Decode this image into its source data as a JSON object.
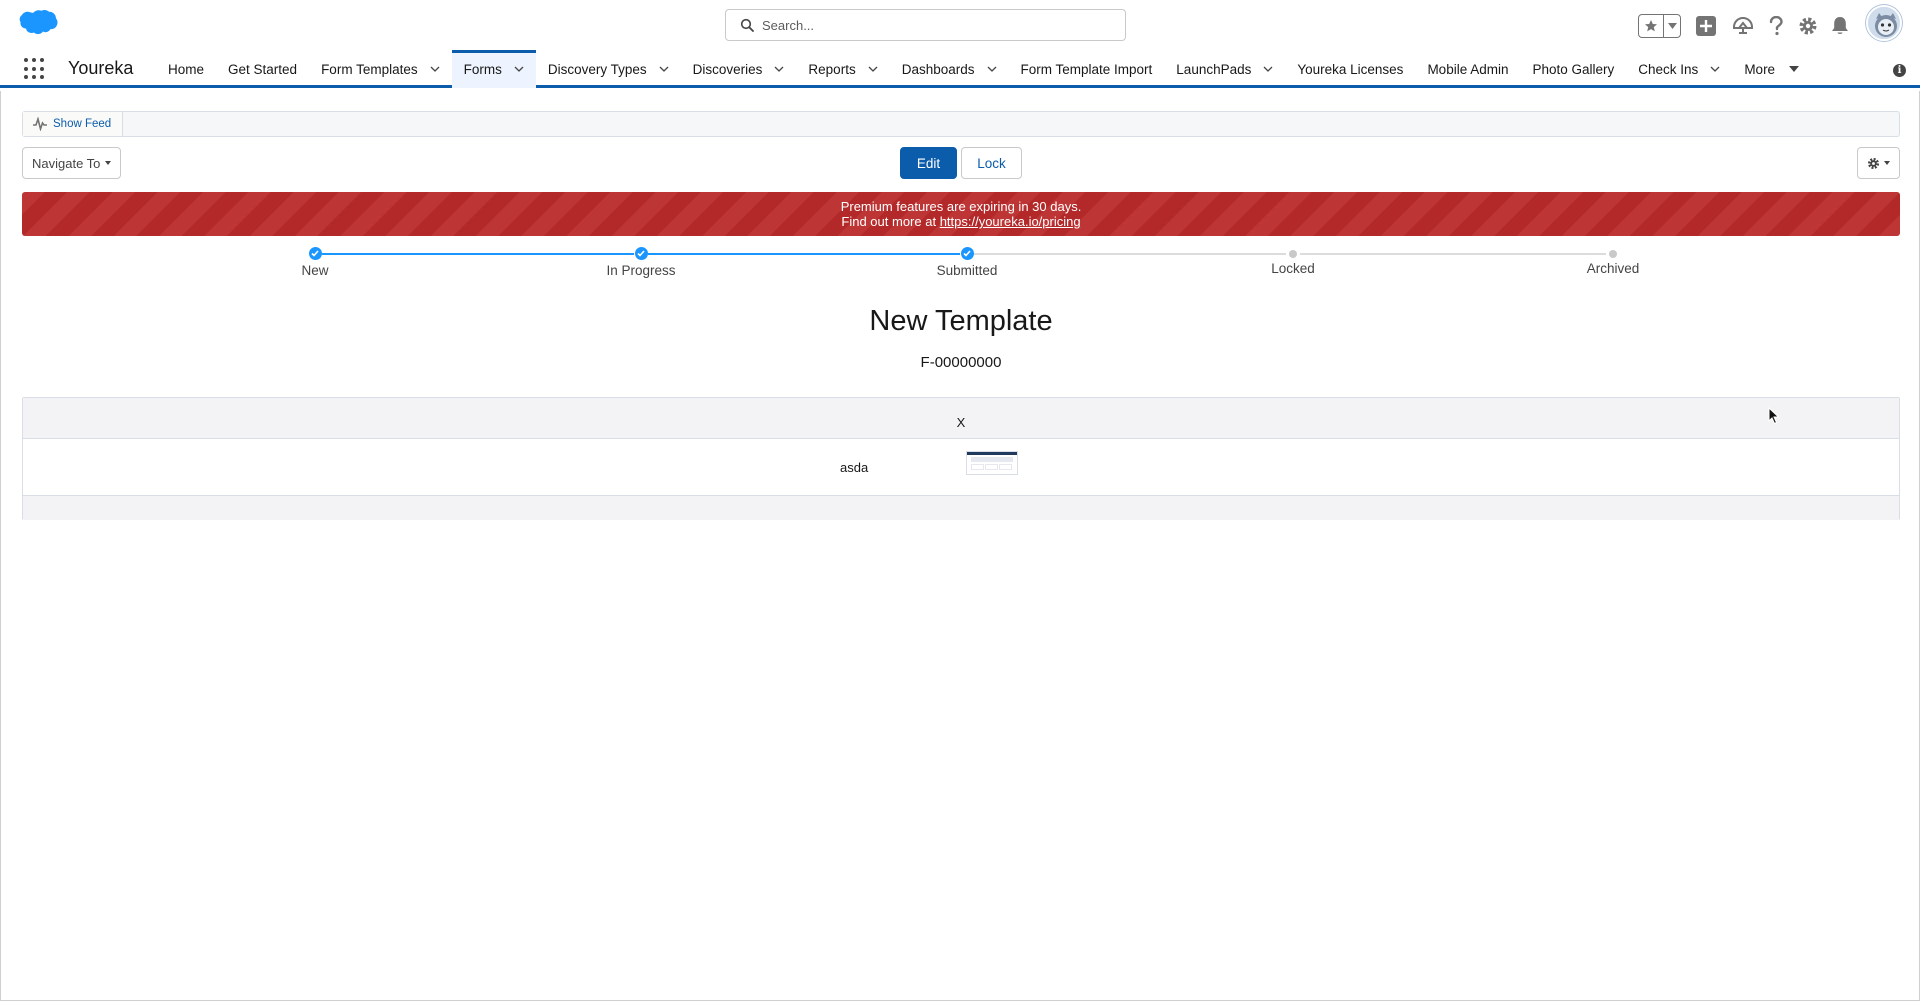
{
  "header": {
    "search_placeholder": "Search..."
  },
  "nav": {
    "app_name": "Youreka",
    "items": [
      {
        "label": "Home",
        "has_menu": false
      },
      {
        "label": "Get Started",
        "has_menu": false
      },
      {
        "label": "Form Templates",
        "has_menu": true
      },
      {
        "label": "Forms",
        "has_menu": true,
        "active": true
      },
      {
        "label": "Discovery Types",
        "has_menu": true
      },
      {
        "label": "Discoveries",
        "has_menu": true
      },
      {
        "label": "Reports",
        "has_menu": true
      },
      {
        "label": "Dashboards",
        "has_menu": true
      },
      {
        "label": "Form Template Import",
        "has_menu": false
      },
      {
        "label": "LaunchPads",
        "has_menu": true
      },
      {
        "label": "Youreka Licenses",
        "has_menu": false
      },
      {
        "label": "Mobile Admin",
        "has_menu": false
      },
      {
        "label": "Photo Gallery",
        "has_menu": false
      },
      {
        "label": "Check Ins",
        "has_menu": true
      }
    ],
    "more_label": "More"
  },
  "toolbar": {
    "show_feed_label": "Show Feed",
    "navigate_to_label": "Navigate To",
    "edit_label": "Edit",
    "lock_label": "Lock"
  },
  "banner": {
    "line1": "Premium features are expiring in 30 days.",
    "line2_prefix": "Find out more at ",
    "link_text": "https://youreka.io/pricing",
    "color": "#ba2a2a"
  },
  "path": {
    "steps": [
      {
        "label": "New",
        "complete": true
      },
      {
        "label": "In Progress",
        "complete": true
      },
      {
        "label": "Submitted",
        "complete": true
      },
      {
        "label": "Locked",
        "complete": false
      },
      {
        "label": "Archived",
        "complete": false
      }
    ]
  },
  "record": {
    "title": "New Template",
    "form_id": "F-00000000"
  },
  "table": {
    "header": "X",
    "rows": [
      {
        "name": "asda"
      }
    ]
  },
  "colors": {
    "brand_blue": "#0b5cab",
    "path_blue": "#1b96ff",
    "salesforce_cloud": "#1b96ff"
  }
}
